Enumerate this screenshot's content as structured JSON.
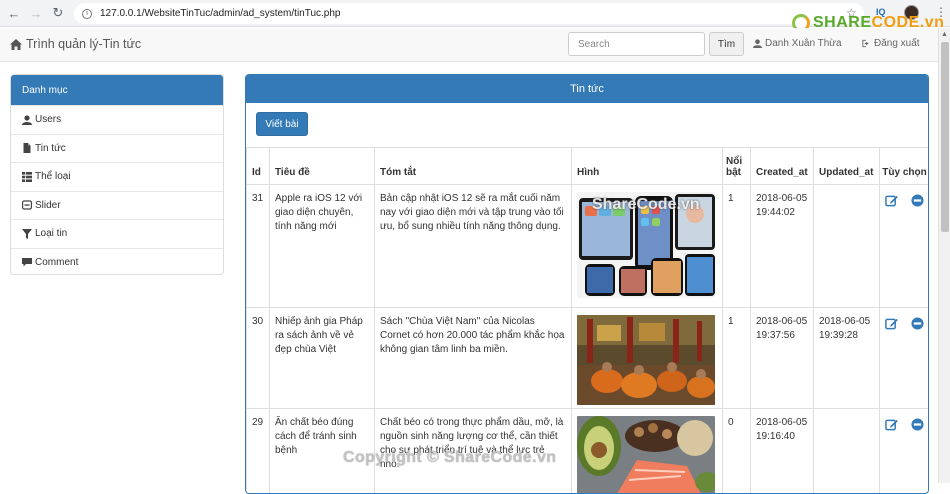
{
  "browser": {
    "url": "127.0.0.1/WebsiteTinTuc/admin/ad_system/tinTuc.php",
    "extension_label": "IQ"
  },
  "watermark": {
    "logo_text_a": "SHARE",
    "logo_text_b": "CODE.vn",
    "center_text": "ShareCode.vn",
    "footer_text": "Copyright © ShareCode.vn"
  },
  "navbar": {
    "brand": "Trình quản lý-Tin tức",
    "search_placeholder": "Search",
    "search_button": "Tìm",
    "user_name": "Danh Xuân Thừa",
    "logout": "Đăng xuất"
  },
  "sidebar": {
    "title": "Danh mục",
    "items": [
      {
        "label": "Users",
        "icon": "user-icon"
      },
      {
        "label": "Tin tức",
        "icon": "file-icon"
      },
      {
        "label": "Thể loại",
        "icon": "th-list-icon"
      },
      {
        "label": "Slider",
        "icon": "slider-icon"
      },
      {
        "label": "Loại tin",
        "icon": "filter-icon"
      },
      {
        "label": "Comment",
        "icon": "comment-icon"
      }
    ]
  },
  "panel": {
    "title": "Tin tức",
    "write_button": "Viết bài",
    "columns": [
      "Id",
      "Tiêu đề",
      "Tóm tắt",
      "Hình",
      "Nổi bật",
      "Created_at",
      "Updated_at",
      "Tùy chọn"
    ],
    "rows": [
      {
        "id": "31",
        "title": "Apple ra iOS 12 với giao diện chuyên, tính năng mới",
        "summary": "Bản cập nhật iOS 12 sẽ ra mắt cuối năm nay với giao diện mới và tập trung vào tối ưu, bổ sung nhiều tính năng thông dụng.",
        "image": "ios12-devices",
        "featured": "1",
        "created_at": "2018-06-05 19:44:02",
        "updated_at": ""
      },
      {
        "id": "30",
        "title": "Nhiếp ảnh gia Pháp ra sách ảnh về vẻ đẹp chùa Việt",
        "summary": "Sách \"Chùa Việt Nam\" của Nicolas Cornet có hơn 20.000 tác phẩm khắc họa không gian tâm linh ba miền.",
        "image": "pagoda-monks",
        "featured": "1",
        "created_at": "2018-06-05 19:37:56",
        "updated_at": "2018-06-05 19:39:28"
      },
      {
        "id": "29",
        "title": "Ăn chất béo đúng cách để tránh sinh bệnh",
        "summary": "Chất béo có trong thực phẩm dầu, mỡ, là nguồn sinh năng lượng cơ thể, cần thiết cho sự phát triển trí tuệ và thể lực trẻ nhỏ.",
        "image": "healthy-fats-food",
        "featured": "0",
        "created_at": "2018-06-05 19:16:40",
        "updated_at": ""
      }
    ]
  }
}
